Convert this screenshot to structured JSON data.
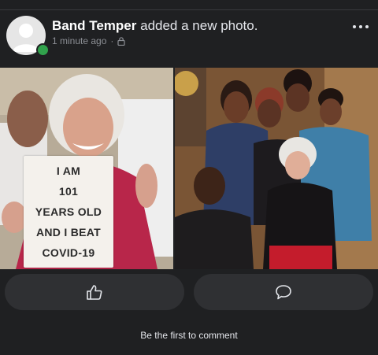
{
  "post": {
    "author": "Band Temper",
    "action": "added a new photo.",
    "time": "1 minute ago",
    "privacy_icon": "lock-icon",
    "more_icon": "more-dots-icon"
  },
  "photo_left": {
    "sign_lines": [
      "I AM",
      "101",
      "YEARS OLD",
      "AND I BEAT",
      "COVID-19"
    ]
  },
  "actions": {
    "like_icon": "thumbs-up-icon",
    "comment_icon": "comment-bubble-icon"
  },
  "footer": {
    "text": "Be the first to comment"
  },
  "colors": {
    "background": "#1f2022",
    "button": "#2f3033",
    "online": "#31a24c"
  }
}
